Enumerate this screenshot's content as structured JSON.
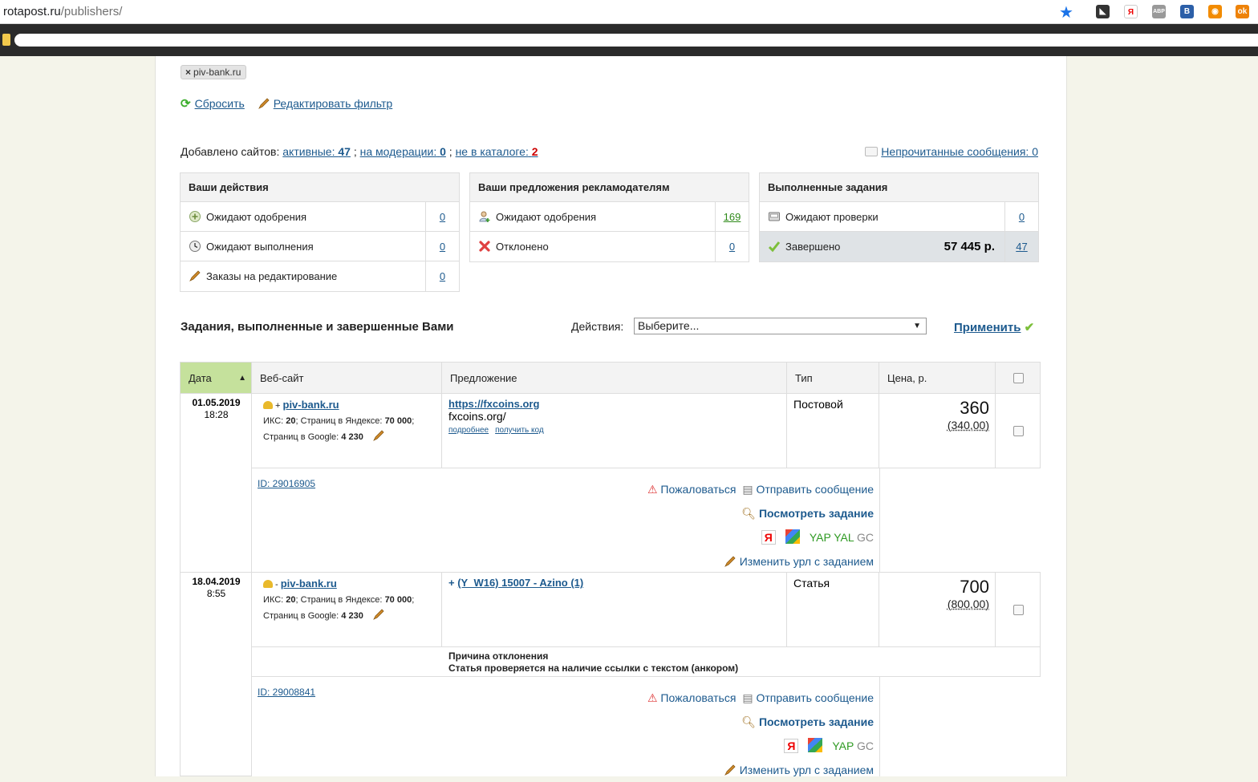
{
  "browser": {
    "url_host": "rotapost.ru",
    "url_path": "/publishers/",
    "extensions": [
      "vk-icon",
      "yandex-icon",
      "abp-icon",
      "b-icon",
      "rss-icon",
      "ok-icon"
    ]
  },
  "filter": {
    "tag": "piv-bank.ru",
    "reset": "Сбросить",
    "edit": "Редактировать фильтр"
  },
  "stats": {
    "prefix": "Добавлено сайтов:",
    "active_label": "активные:",
    "active_value": "47",
    "moderation_label": "на модерации:",
    "moderation_value": "0",
    "notcatalog_label": "не в каталоге:",
    "notcatalog_value": "2",
    "unread": "Непрочитанные сообщения: 0"
  },
  "boxes": {
    "actions": {
      "title": "Ваши действия",
      "rows": [
        {
          "label": "Ожидают одобрения",
          "count": "0"
        },
        {
          "label": "Ожидают выполнения",
          "count": "0"
        },
        {
          "label": "Заказы на редактирование",
          "count": "0"
        }
      ]
    },
    "offers": {
      "title": "Ваши предложения рекламодателям",
      "rows": [
        {
          "label": "Ожидают одобрения",
          "count": "169"
        },
        {
          "label": "Отклонено",
          "count": "0"
        }
      ]
    },
    "done": {
      "title": "Выполненные задания",
      "rows": [
        {
          "label": "Ожидают проверки",
          "count": "0"
        },
        {
          "label": "Завершено",
          "amount": "57 445 р.",
          "count": "47"
        }
      ]
    }
  },
  "section": {
    "title": "Задания, выполненные и завершенные Вами",
    "actions_label": "Действия:",
    "select_value": "Выберите...",
    "apply": "Применить"
  },
  "table": {
    "headers": [
      "Дата",
      "Веб-сайт",
      "Предложение",
      "Тип",
      "Цена, р."
    ],
    "rows": [
      {
        "date": "01.05.2019",
        "time": "18:28",
        "sign": "+",
        "site": "piv-bank.ru",
        "iks_label": "ИКС:",
        "iks": "20",
        "yandex_label": "; Страниц в Яндексе:",
        "yandex": "70 000",
        "google_label": "Страниц в Google:",
        "google": "4 230",
        "offer_link": "https://fxcoins.org",
        "offer_text": "fxcoins.org/",
        "more": "подробнее",
        "get_code": "получить код",
        "type": "Постовой",
        "price": "360",
        "price_orig": "(340,00)",
        "id": "ID: 29016905",
        "complain": "Пожаловаться",
        "send_msg": "Отправить сообщение",
        "view_task": "Посмотреть задание",
        "yap": "YAP",
        "yal": "YAL",
        "gc": "GC",
        "change_url": "Изменить урл с заданием"
      },
      {
        "date": "18.04.2019",
        "time": "8:55",
        "sign": "-",
        "site": "piv-bank.ru",
        "iks_label": "ИКС:",
        "iks": "20",
        "yandex_label": "; Страниц в Яндексе:",
        "yandex": "70 000",
        "google_label": "Страниц в Google:",
        "google": "4 230",
        "offer_sign": "+",
        "offer_link": "(Y_W16) 15007 - Azino (1)",
        "type": "Статья",
        "price": "700",
        "price_orig": "(800,00)",
        "reject_title": "Причина отклонения",
        "reject_text": "Статья проверяется на наличие ссылки с текстом (анкором)",
        "id": "ID: 29008841",
        "complain": "Пожаловаться",
        "send_msg": "Отправить сообщение",
        "view_task": "Посмотреть задание",
        "yap": "YAP",
        "gc": "GC",
        "change_url": "Изменить урл с заданием"
      }
    ]
  }
}
